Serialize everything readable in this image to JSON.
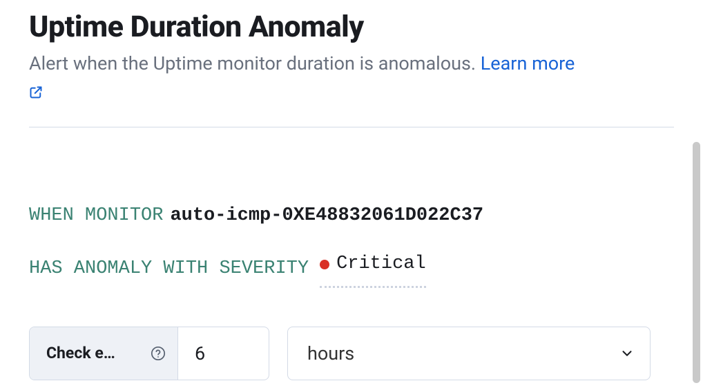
{
  "header": {
    "title": "Uptime Duration Anomaly",
    "subtitle": "Alert when the Uptime monitor duration is anomalous.",
    "learn_more": "Learn more"
  },
  "rule": {
    "when_monitor_kw": "WHEN MONITOR",
    "monitor_value": "auto-icmp-0XE48832061D022C37",
    "severity_kw": "HAS ANOMALY WITH SEVERITY",
    "severity_value": "Critical",
    "severity_color": "#d93025"
  },
  "check": {
    "label": "Check e…",
    "value": "6",
    "unit": "hours"
  }
}
